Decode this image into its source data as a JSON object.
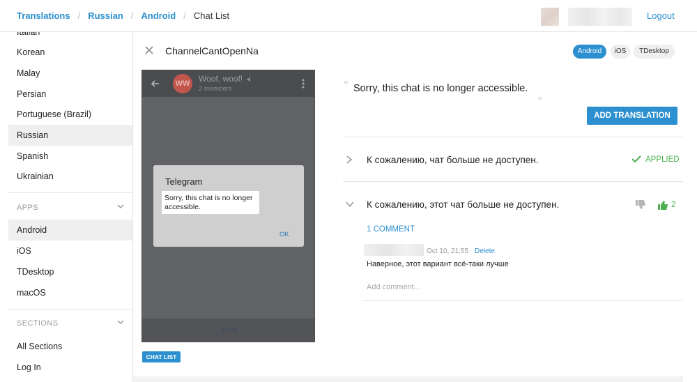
{
  "breadcrumb": {
    "items": [
      "Translations",
      "Russian",
      "Android"
    ],
    "separator": "/",
    "current": "Chat List"
  },
  "header": {
    "logout_label": "Logout"
  },
  "sidebar": {
    "languages": [
      {
        "label": "Italian",
        "active": false
      },
      {
        "label": "Korean",
        "active": false
      },
      {
        "label": "Malay",
        "active": false
      },
      {
        "label": "Persian",
        "active": false
      },
      {
        "label": "Portuguese (Brazil)",
        "active": false
      },
      {
        "label": "Russian",
        "active": true
      },
      {
        "label": "Spanish",
        "active": false
      },
      {
        "label": "Ukrainian",
        "active": false
      }
    ],
    "apps_heading": "APPS",
    "apps": [
      {
        "label": "Android",
        "active": true
      },
      {
        "label": "iOS",
        "active": false
      },
      {
        "label": "TDesktop",
        "active": false
      },
      {
        "label": "macOS",
        "active": false
      }
    ],
    "sections_heading": "SECTIONS",
    "sections": [
      {
        "label": "All Sections"
      },
      {
        "label": "Log In"
      }
    ]
  },
  "key": {
    "title": "ChannelCantOpenNa",
    "platform_tags": [
      "Android",
      "iOS",
      "TDesktop"
    ]
  },
  "screenshot": {
    "chat_name": "Woof, woof!",
    "chat_subtitle": "2 members",
    "avatar_initials": "WW",
    "dialog_title": "Telegram",
    "dialog_message": "Sorry, this chat is no longer accessible.",
    "dialog_ok": "OK",
    "join_label": "JOIN",
    "section_tag": "CHAT LIST"
  },
  "source": {
    "quote_open": "“",
    "quote_close": "„",
    "text": "Sorry, this chat is no longer accessible.",
    "add_translation_label": "ADD TRANSLATION"
  },
  "translations": [
    {
      "text": "К сожалению, чат больше не доступен.",
      "status": "APPLIED",
      "expanded": false
    },
    {
      "text": "К сожалению, этот чат больше не доступен.",
      "expanded": true,
      "upvotes": "2",
      "comments_label": "1 COMMENT",
      "comment": {
        "date": "Oct 10, 21:55",
        "separator": "·",
        "delete_label": "Delete",
        "text": "Наверное, этот вариант всё-таки лучше"
      },
      "add_comment_placeholder": "Add comment..."
    }
  ],
  "colors": {
    "accent": "#2b8fd0",
    "applied": "#4caf50",
    "active_item_bg": "#efefef"
  }
}
